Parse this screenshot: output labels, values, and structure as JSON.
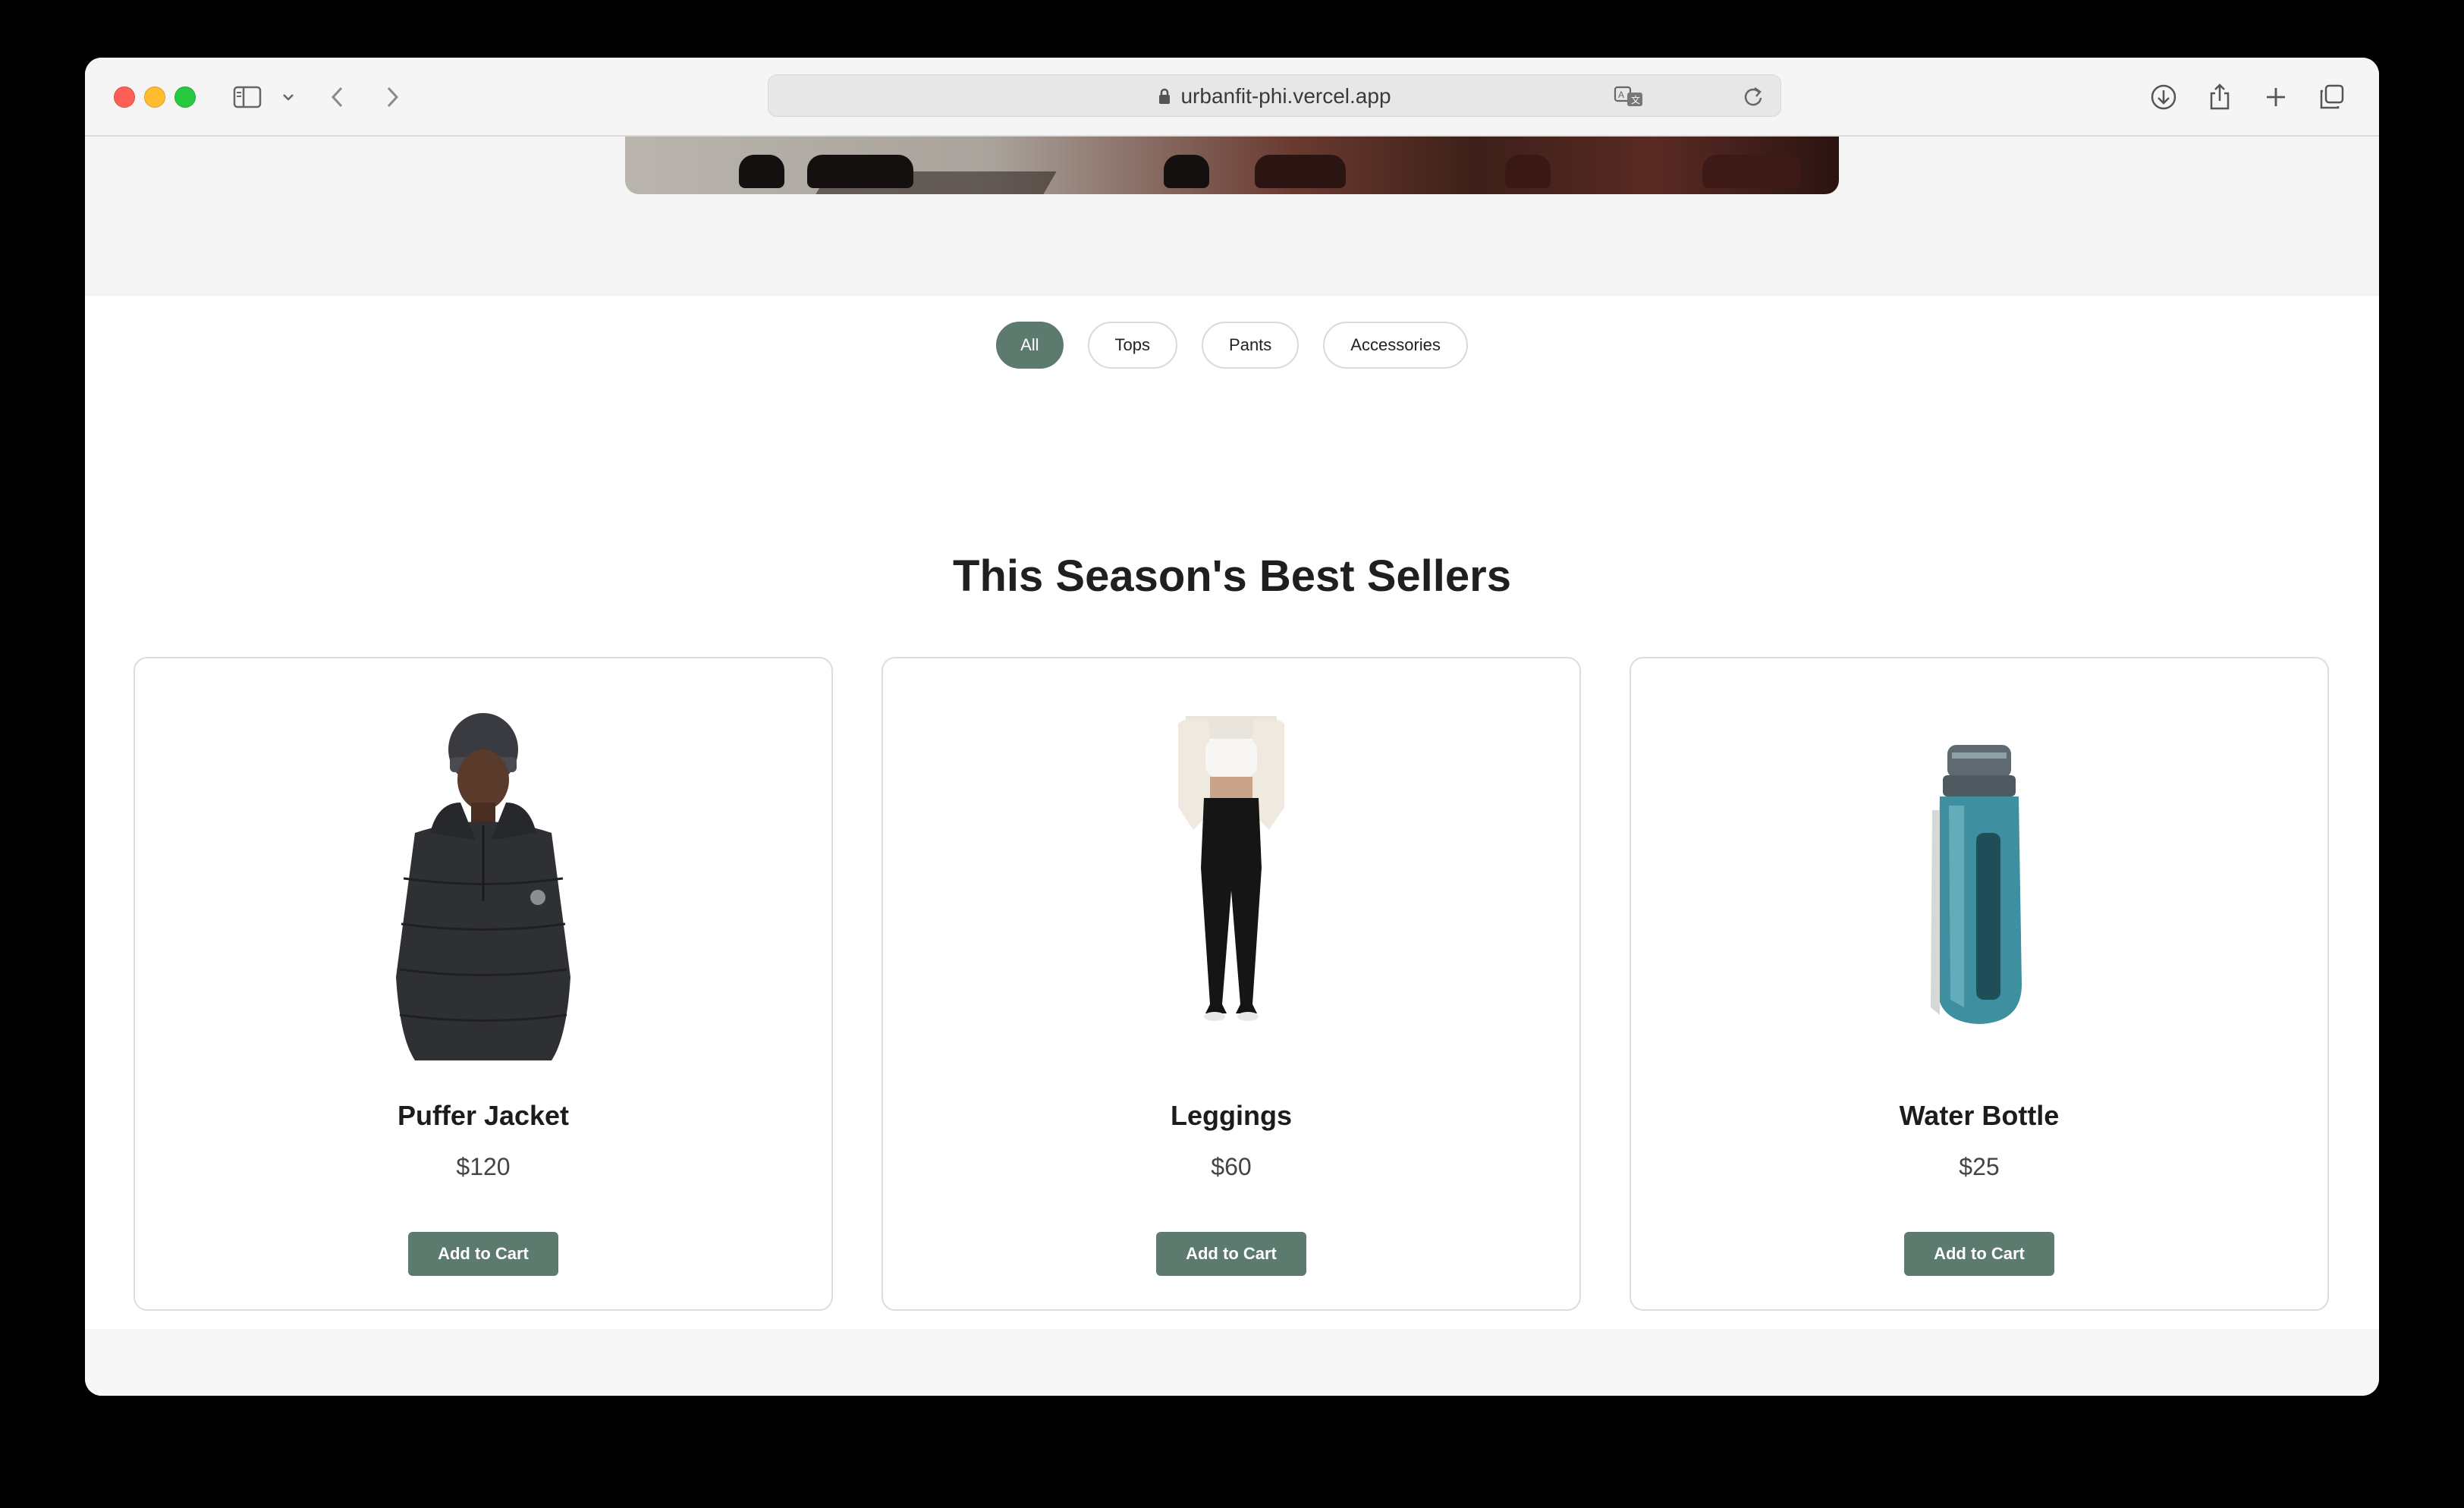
{
  "browser": {
    "url": "urbanfit-phi.vercel.app",
    "icons": [
      "sidebar-icon",
      "chevron-down-icon",
      "back-icon",
      "forward-icon",
      "lock-icon",
      "translate-icon",
      "reload-icon",
      "download-icon",
      "share-icon",
      "new-tab-icon",
      "tabs-overview-icon"
    ]
  },
  "filters": [
    {
      "label": "All",
      "active": true
    },
    {
      "label": "Tops",
      "active": false
    },
    {
      "label": "Pants",
      "active": false
    },
    {
      "label": "Accessories",
      "active": false
    }
  ],
  "section": {
    "title": "This Season's Best Sellers"
  },
  "products": [
    {
      "name": "Puffer Jacket",
      "price": "$120",
      "button": "Add to Cart",
      "image": "puffer-jacket-image"
    },
    {
      "name": "Leggings",
      "price": "$60",
      "button": "Add to Cart",
      "image": "leggings-image"
    },
    {
      "name": "Water Bottle",
      "price": "$25",
      "button": "Add to Cart",
      "image": "water-bottle-image"
    }
  ],
  "colors": {
    "accent": "#5c7a6d",
    "page_bg": "#ffffff",
    "band_bg": "#f4f4f4"
  }
}
